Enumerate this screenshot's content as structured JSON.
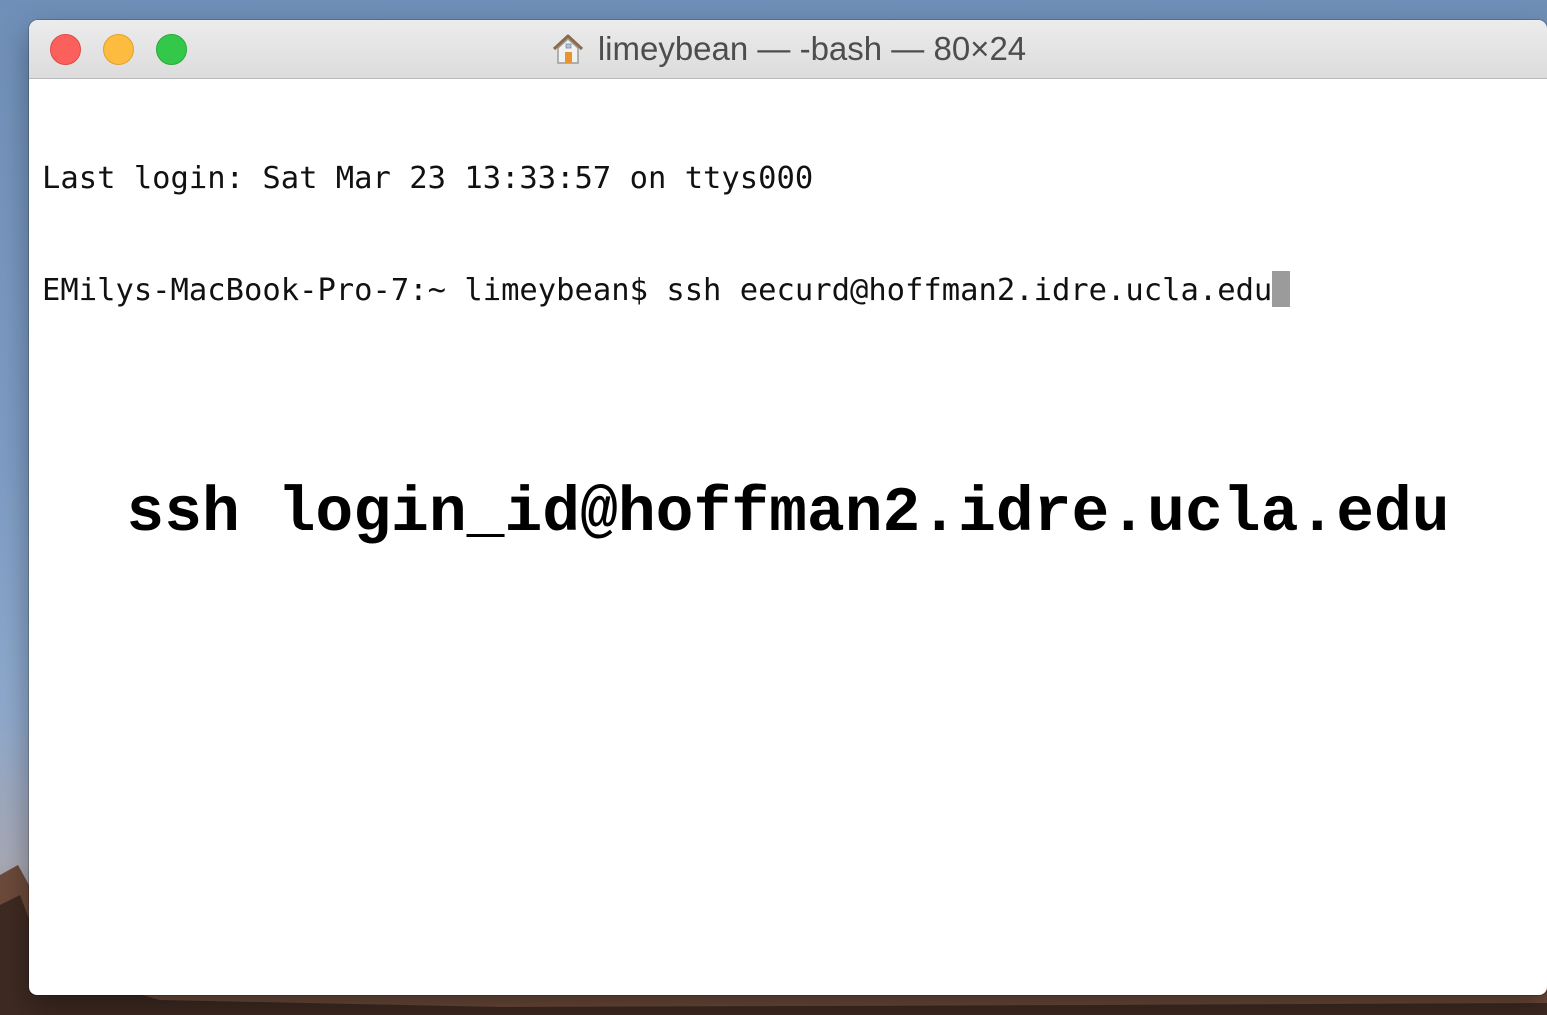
{
  "window": {
    "title": "limeybean — -bash — 80×24",
    "title_icon": "home-icon"
  },
  "terminal": {
    "lines": [
      "Last login: Sat Mar 23 13:33:57 on ttys000",
      "EMilys-MacBook-Pro-7:~ limeybean$ ssh eecurd@hoffman2.idre.ucla.edu"
    ]
  },
  "overlay": {
    "text": "ssh login_id@hoffman2.idre.ucla.edu"
  },
  "colors": {
    "close": "#fc605c",
    "minimize": "#fdbc40",
    "zoom": "#34c84a",
    "cursor": "#9b9b9b"
  }
}
